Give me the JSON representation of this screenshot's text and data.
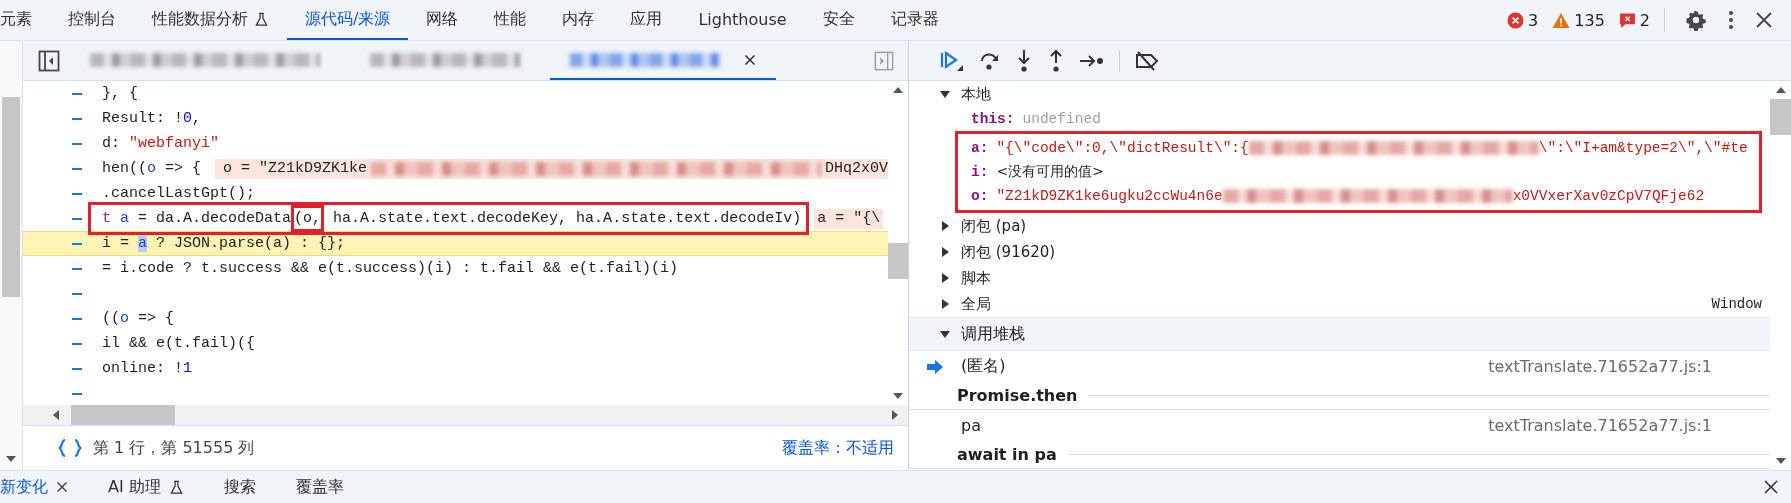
{
  "tabs": [
    {
      "label": "元素",
      "selected": false,
      "experimental": false
    },
    {
      "label": "控制台",
      "selected": false,
      "experimental": false
    },
    {
      "label": "性能数据分析",
      "selected": false,
      "experimental": true
    },
    {
      "label": "源代码/来源",
      "selected": true,
      "experimental": false
    },
    {
      "label": "网络",
      "selected": false,
      "experimental": false
    },
    {
      "label": "性能",
      "selected": false,
      "experimental": false
    },
    {
      "label": "内存",
      "selected": false,
      "experimental": false
    },
    {
      "label": "应用",
      "selected": false,
      "experimental": false
    },
    {
      "label": "Lighthouse",
      "selected": false,
      "experimental": false
    },
    {
      "label": "安全",
      "selected": false,
      "experimental": false
    },
    {
      "label": "记录器",
      "selected": false,
      "experimental": false
    }
  ],
  "counters": {
    "errors": "3",
    "warnings": "135",
    "issues": "2"
  },
  "file_tabs": [
    {
      "kind": "blurred",
      "selected": false,
      "closable": false
    },
    {
      "kind": "blurred",
      "selected": false,
      "closable": false
    },
    {
      "kind": "blurred",
      "selected": true,
      "closable": true
    }
  ],
  "code_lines": [
    {
      "highlighted": false,
      "boxed": false,
      "segments": [
        {
          "kind": "plain",
          "text": "}, {"
        }
      ]
    },
    {
      "highlighted": false,
      "boxed": false,
      "segments": [
        {
          "kind": "plain",
          "text": "Result: !"
        },
        {
          "kind": "number",
          "text": "0"
        },
        {
          "kind": "plain",
          "text": ","
        }
      ]
    },
    {
      "highlighted": false,
      "boxed": false,
      "segments": [
        {
          "kind": "plain",
          "text": "d: "
        },
        {
          "kind": "string",
          "text": "\"webfanyi\""
        }
      ]
    },
    {
      "highlighted": false,
      "boxed": false,
      "segments": [
        {
          "kind": "plain",
          "text": "hen(("
        },
        {
          "kind": "name",
          "text": "o"
        },
        {
          "kind": "plain",
          "text": " => {"
        }
      ],
      "inline": [
        {
          "kind": "plain",
          "text": "o = \"Z21kD9ZK1ke"
        },
        {
          "kind": "blur"
        },
        {
          "kind": "plain",
          "text": "DHq2x0V"
        }
      ]
    },
    {
      "highlighted": false,
      "boxed": false,
      "segments": [
        {
          "kind": "plain",
          "text": ".cancelLastGpt();"
        }
      ]
    },
    {
      "highlighted": false,
      "boxed": true,
      "segments": [
        {
          "kind": "keyword",
          "text": "t "
        },
        {
          "kind": "name",
          "text": "a"
        },
        {
          "kind": "plain",
          "text": " = da.A.decodeData"
        },
        {
          "kind": "plain",
          "text": "(o,",
          "boxed": true
        },
        {
          "kind": "plain",
          "text": " ha.A.state.text.decodeKey, ha.A.state.text.decodeIv)"
        }
      ],
      "inline": [
        {
          "kind": "plain",
          "text": "a = \"{\\"
        }
      ]
    },
    {
      "highlighted": true,
      "boxed": false,
      "segments": [
        {
          "kind": "plain",
          "text": "i = "
        },
        {
          "kind": "selection",
          "text": "a"
        },
        {
          "kind": "plain",
          "text": " ? JSON.parse(a) : {};"
        }
      ]
    },
    {
      "highlighted": false,
      "boxed": false,
      "segments": [
        {
          "kind": "plain",
          "text": "= i.code ? t.success && e(t.success)(i) : t.fail && e(t.fail)(i)"
        }
      ]
    },
    {
      "highlighted": false,
      "boxed": false
    },
    {
      "highlighted": false,
      "boxed": false,
      "segments": [
        {
          "kind": "plain",
          "text": "(("
        },
        {
          "kind": "name",
          "text": "o"
        },
        {
          "kind": "plain",
          "text": " => {"
        }
      ]
    },
    {
      "highlighted": false,
      "boxed": false,
      "segments": [
        {
          "kind": "plain",
          "text": "il && e(t.fail)({"
        }
      ]
    },
    {
      "highlighted": false,
      "boxed": false,
      "segments": [
        {
          "kind": "plain",
          "text": "online: !"
        },
        {
          "kind": "number",
          "text": "1"
        }
      ]
    },
    {
      "highlighted": false,
      "boxed": false
    }
  ],
  "status": {
    "position": "第 1 行，第 51555 列",
    "coverage": "覆盖率：不适用"
  },
  "scope": {
    "title": "本地",
    "expanded": true,
    "variables": [
      {
        "name": "this:",
        "boxed": false,
        "value": [
          {
            "kind": "undefined",
            "text": "undefined"
          }
        ]
      },
      {
        "name": "a:",
        "boxed": true,
        "value": [
          {
            "kind": "string",
            "text": "\"{\\\"code\\\":0,\\\"dictResult\\\":{"
          },
          {
            "kind": "blur"
          },
          {
            "kind": "string",
            "text": "\\\":\\\"I+am&type=2\\\",\\\"#te"
          }
        ]
      },
      {
        "name": "i:",
        "boxed": true,
        "value": [
          {
            "kind": "plain",
            "text": "<没有可用的值>"
          }
        ]
      },
      {
        "name": "o:",
        "boxed": true,
        "value": [
          {
            "kind": "string",
            "text": "\"Z21kD9ZK1ke6ugku2ccWu4n6e"
          },
          {
            "kind": "blur"
          },
          {
            "kind": "string",
            "text": "x0VVxerXav0zCpV7QFje62"
          }
        ]
      }
    ],
    "sections": [
      {
        "label": "闭包 (pa)",
        "expanded": false
      },
      {
        "label": "闭包 (91620)",
        "expanded": false
      },
      {
        "label": "脚本",
        "expanded": false
      },
      {
        "label": "全局",
        "expanded": false,
        "value": "Window"
      }
    ]
  },
  "call_stack": {
    "title": "调用堆栈",
    "expanded": true,
    "frames": [
      {
        "kind": "frame",
        "name": "(匿名)",
        "location": "textTranslate.71652a77.js:1",
        "current": true
      },
      {
        "kind": "async",
        "name": "Promise.then"
      },
      {
        "kind": "frame",
        "name": "pa",
        "location": "textTranslate.71652a77.js:1",
        "current": false
      },
      {
        "kind": "async",
        "name": "await in pa"
      }
    ]
  },
  "drawer_tabs": [
    {
      "label": "新变化",
      "selected": true,
      "closable": true,
      "experimental": false
    },
    {
      "label": "AI 助理",
      "selected": false,
      "closable": false,
      "experimental": true
    },
    {
      "label": "搜索",
      "selected": false,
      "closable": false,
      "experimental": false
    },
    {
      "label": "覆盖率",
      "selected": false,
      "closable": false,
      "experimental": false
    }
  ]
}
